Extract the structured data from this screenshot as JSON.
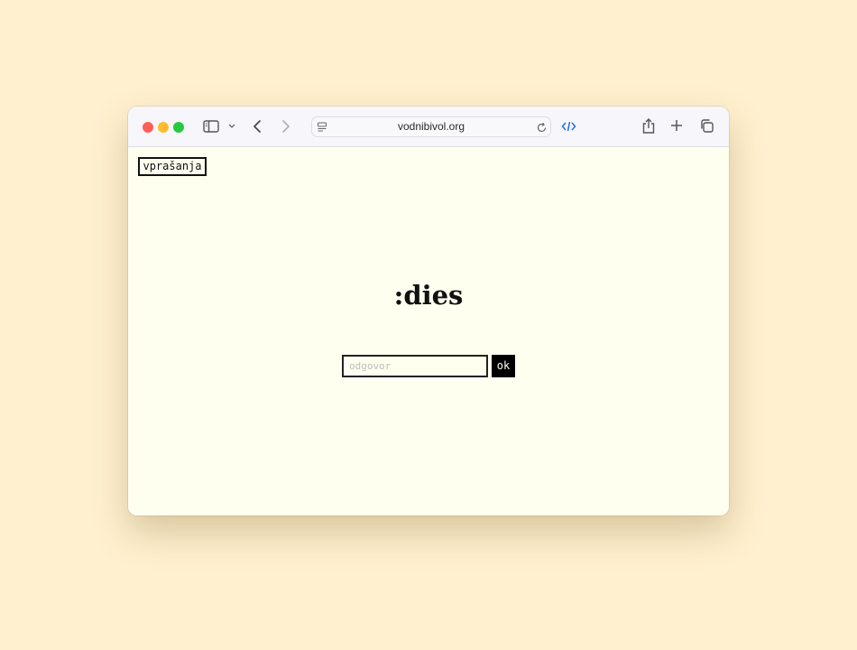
{
  "browser": {
    "url": "vodnibivol.org",
    "icons": {
      "sidebar": "sidebar-icon",
      "tab_chevron": "chevron-down-icon",
      "back": "back-icon",
      "forward": "forward-icon",
      "page_menu": "page-menu-icon",
      "reload": "reload-icon",
      "developer": "code-icon",
      "share": "share-icon",
      "new_tab": "plus-icon",
      "tabs_overview": "tabs-overview-icon"
    },
    "colors": {
      "close": "#ff5f57",
      "minimize": "#febc2e",
      "maximize": "#28c840",
      "accent": "#1e6fe0"
    }
  },
  "page": {
    "nav_link": "vprašanja",
    "riddle": ":dies",
    "answer_placeholder": "odgovor",
    "answer_value": "",
    "submit_label": "ok",
    "colors": {
      "background": "#fffff0",
      "text": "#111111",
      "button_bg": "#000000",
      "button_text": "#ffffff"
    }
  }
}
